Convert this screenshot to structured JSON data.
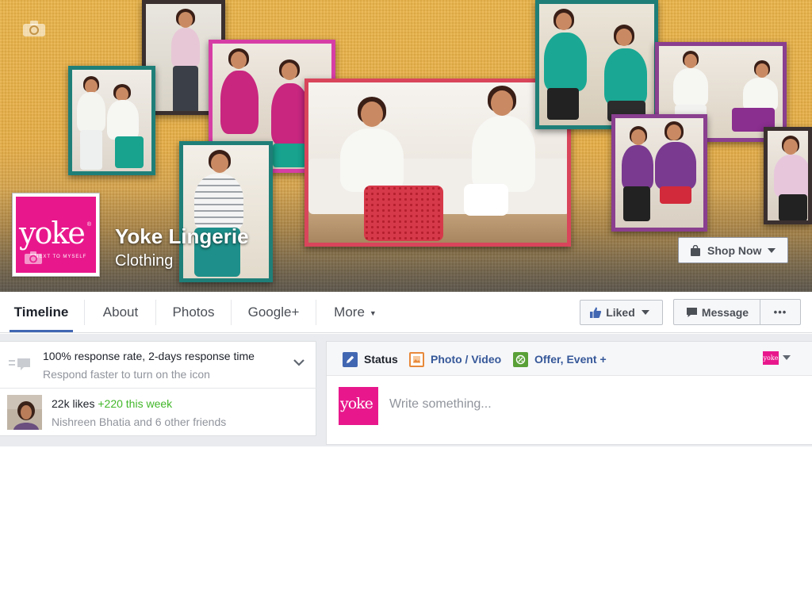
{
  "page": {
    "name": "Yoke Lingerie",
    "category": "Clothing",
    "logo": {
      "word": "yoke",
      "registered": "®",
      "tagline": "NEXT TO MYSELF"
    }
  },
  "header": {
    "shop_now_label": "Shop Now"
  },
  "nav": {
    "tabs": [
      {
        "label": "Timeline",
        "active": true
      },
      {
        "label": "About"
      },
      {
        "label": "Photos"
      },
      {
        "label": "Google+"
      },
      {
        "label": "More"
      }
    ],
    "liked_label": "Liked",
    "message_label": "Message",
    "more_dots": "•••"
  },
  "left": {
    "response": {
      "title": "100% response rate, 2-days response time",
      "subtitle": "Respond faster to turn on the icon"
    },
    "likes": {
      "count": "22k likes",
      "week": "+220 this week",
      "friends": "Nishreen Bhatia and 6 other friends"
    }
  },
  "composer": {
    "tabs": [
      {
        "label": "Status",
        "icon": "pencil-icon"
      },
      {
        "label": "Photo / Video",
        "icon": "photo-icon"
      },
      {
        "label": "Offer, Event +",
        "icon": "offer-icon"
      }
    ],
    "mini_logo": "yoke",
    "placeholder": "Write something..."
  },
  "colors": {
    "accent": "#4267b2",
    "brand_pink": "#e8188c",
    "link": "#365899",
    "positive": "#42b72a"
  }
}
